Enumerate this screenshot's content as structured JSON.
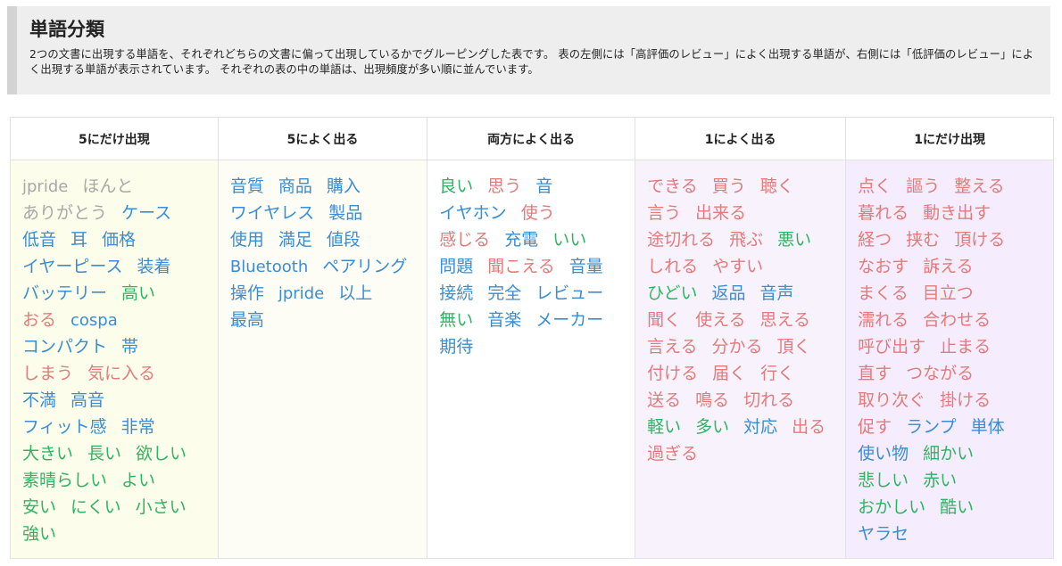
{
  "header": {
    "title": "単語分類",
    "description": "2つの文書に出現する単語を、それぞれどちらの文書に偏って出現しているかでグルーピングした表です。 表の左側には「高評価のレビュー」によく出現する単語が、右側には「低評価のレビュー」によく出現する単語が表示されています。 それぞれの表の中の単語は、出現頻度が多い順に並んでいます。"
  },
  "colors": {
    "blue": "#3a8dd3",
    "green": "#2eb563",
    "red": "#e57a7a",
    "gray": "#a8a8a8"
  },
  "columns": [
    {
      "header": "5にだけ出現",
      "background": "yellow",
      "lines": [
        [
          {
            "text": "jpride",
            "color": "gray"
          },
          {
            "text": "ほんと",
            "color": "gray"
          }
        ],
        [
          {
            "text": "ありがとう",
            "color": "gray"
          },
          {
            "text": "ケース",
            "color": "blue"
          }
        ],
        [
          {
            "text": "低音",
            "color": "blue"
          },
          {
            "text": "耳",
            "color": "blue"
          },
          {
            "text": "価格",
            "color": "blue"
          }
        ],
        [
          {
            "text": "イヤーピース",
            "color": "blue"
          },
          {
            "text": "装着",
            "color": "blue"
          }
        ],
        [
          {
            "text": "バッテリー",
            "color": "blue"
          },
          {
            "text": "高い",
            "color": "green"
          }
        ],
        [
          {
            "text": "おる",
            "color": "red"
          },
          {
            "text": "cospa",
            "color": "blue"
          }
        ],
        [
          {
            "text": "コンパクト",
            "color": "blue"
          },
          {
            "text": "帯",
            "color": "blue"
          }
        ],
        [
          {
            "text": "しまう",
            "color": "red"
          },
          {
            "text": "気に入る",
            "color": "red"
          }
        ],
        [
          {
            "text": "不満",
            "color": "blue"
          },
          {
            "text": "高音",
            "color": "blue"
          }
        ],
        [
          {
            "text": "フィット感",
            "color": "blue"
          },
          {
            "text": "非常",
            "color": "blue"
          }
        ],
        [
          {
            "text": "大きい",
            "color": "green"
          },
          {
            "text": "長い",
            "color": "green"
          },
          {
            "text": "欲しい",
            "color": "green"
          }
        ],
        [
          {
            "text": "素晴らしい",
            "color": "green"
          },
          {
            "text": "よい",
            "color": "green"
          }
        ],
        [
          {
            "text": "安い",
            "color": "green"
          },
          {
            "text": "にくい",
            "color": "green"
          },
          {
            "text": "小さい",
            "color": "green"
          }
        ],
        [
          {
            "text": "強い",
            "color": "green"
          }
        ]
      ]
    },
    {
      "header": "5によく出る",
      "background": "cream",
      "lines": [
        [
          {
            "text": "音質",
            "color": "blue"
          },
          {
            "text": "商品",
            "color": "blue"
          },
          {
            "text": "購入",
            "color": "blue"
          }
        ],
        [
          {
            "text": "ワイヤレス",
            "color": "blue"
          },
          {
            "text": "製品",
            "color": "blue"
          }
        ],
        [
          {
            "text": "使用",
            "color": "blue"
          },
          {
            "text": "満足",
            "color": "blue"
          },
          {
            "text": "値段",
            "color": "blue"
          }
        ],
        [
          {
            "text": "Bluetooth",
            "color": "blue"
          },
          {
            "text": "ペアリング",
            "color": "blue"
          }
        ],
        [
          {
            "text": "操作",
            "color": "blue"
          },
          {
            "text": "jpride",
            "color": "blue"
          },
          {
            "text": "以上",
            "color": "blue"
          }
        ],
        [
          {
            "text": "最高",
            "color": "blue"
          }
        ]
      ]
    },
    {
      "header": "両方によく出る",
      "background": "white",
      "lines": [
        [
          {
            "text": "良い",
            "color": "green"
          },
          {
            "text": "思う",
            "color": "red"
          },
          {
            "text": "音",
            "color": "blue"
          }
        ],
        [
          {
            "text": "イヤホン",
            "color": "blue"
          },
          {
            "text": "使う",
            "color": "red"
          }
        ],
        [
          {
            "text": "感じる",
            "color": "red"
          },
          {
            "text": "充電",
            "color": "blue"
          },
          {
            "text": "いい",
            "color": "green"
          }
        ],
        [
          {
            "text": "問題",
            "color": "blue"
          },
          {
            "text": "聞こえる",
            "color": "red"
          },
          {
            "text": "音量",
            "color": "blue"
          }
        ],
        [
          {
            "text": "接続",
            "color": "blue"
          },
          {
            "text": "完全",
            "color": "blue"
          },
          {
            "text": "レビュー",
            "color": "blue"
          }
        ],
        [
          {
            "text": "無い",
            "color": "green"
          },
          {
            "text": "音楽",
            "color": "blue"
          },
          {
            "text": "メーカー",
            "color": "blue"
          }
        ],
        [
          {
            "text": "期待",
            "color": "blue"
          }
        ]
      ]
    },
    {
      "header": "1によく出る",
      "background": "lavender",
      "lines": [
        [
          {
            "text": "できる",
            "color": "red"
          },
          {
            "text": "買う",
            "color": "red"
          },
          {
            "text": "聴く",
            "color": "red"
          }
        ],
        [
          {
            "text": "言う",
            "color": "red"
          },
          {
            "text": "出来る",
            "color": "red"
          }
        ],
        [
          {
            "text": "途切れる",
            "color": "red"
          },
          {
            "text": "飛ぶ",
            "color": "red"
          },
          {
            "text": "悪い",
            "color": "green"
          }
        ],
        [
          {
            "text": "しれる",
            "color": "red"
          },
          {
            "text": "やすい",
            "color": "red"
          }
        ],
        [
          {
            "text": "ひどい",
            "color": "green"
          },
          {
            "text": "返品",
            "color": "blue"
          },
          {
            "text": "音声",
            "color": "blue"
          }
        ],
        [
          {
            "text": "聞く",
            "color": "red"
          },
          {
            "text": "使える",
            "color": "red"
          },
          {
            "text": "思える",
            "color": "red"
          }
        ],
        [
          {
            "text": "言える",
            "color": "red"
          },
          {
            "text": "分かる",
            "color": "red"
          },
          {
            "text": "頂く",
            "color": "red"
          }
        ],
        [
          {
            "text": "付ける",
            "color": "red"
          },
          {
            "text": "届く",
            "color": "red"
          },
          {
            "text": "行く",
            "color": "red"
          }
        ],
        [
          {
            "text": "送る",
            "color": "red"
          },
          {
            "text": "鳴る",
            "color": "red"
          },
          {
            "text": "切れる",
            "color": "red"
          }
        ],
        [
          {
            "text": "軽い",
            "color": "green"
          },
          {
            "text": "多い",
            "color": "green"
          },
          {
            "text": "対応",
            "color": "blue"
          },
          {
            "text": "出る",
            "color": "red"
          }
        ],
        [
          {
            "text": "過ぎる",
            "color": "red"
          }
        ]
      ]
    },
    {
      "header": "1にだけ出現",
      "background": "lilac",
      "lines": [
        [
          {
            "text": "点く",
            "color": "red"
          },
          {
            "text": "謳う",
            "color": "red"
          },
          {
            "text": "整える",
            "color": "red"
          }
        ],
        [
          {
            "text": "暮れる",
            "color": "red"
          },
          {
            "text": "動き出す",
            "color": "red"
          }
        ],
        [
          {
            "text": "経つ",
            "color": "red"
          },
          {
            "text": "挟む",
            "color": "red"
          },
          {
            "text": "頂ける",
            "color": "red"
          }
        ],
        [
          {
            "text": "なおす",
            "color": "red"
          },
          {
            "text": "訴える",
            "color": "red"
          }
        ],
        [
          {
            "text": "まくる",
            "color": "red"
          },
          {
            "text": "目立つ",
            "color": "red"
          }
        ],
        [
          {
            "text": "濡れる",
            "color": "red"
          },
          {
            "text": "合わせる",
            "color": "red"
          }
        ],
        [
          {
            "text": "呼び出す",
            "color": "red"
          },
          {
            "text": "止まる",
            "color": "red"
          }
        ],
        [
          {
            "text": "直す",
            "color": "red"
          },
          {
            "text": "つながる",
            "color": "red"
          }
        ],
        [
          {
            "text": "取り次ぐ",
            "color": "red"
          },
          {
            "text": "掛ける",
            "color": "red"
          }
        ],
        [
          {
            "text": "促す",
            "color": "red"
          },
          {
            "text": "ランプ",
            "color": "blue"
          },
          {
            "text": "単体",
            "color": "blue"
          }
        ],
        [
          {
            "text": "使い物",
            "color": "blue"
          },
          {
            "text": "細かい",
            "color": "green"
          }
        ],
        [
          {
            "text": "悲しい",
            "color": "green"
          },
          {
            "text": "赤い",
            "color": "green"
          }
        ],
        [
          {
            "text": "おかしい",
            "color": "green"
          },
          {
            "text": "酷い",
            "color": "green"
          }
        ],
        [
          {
            "text": "ヤラセ",
            "color": "blue"
          }
        ]
      ]
    }
  ]
}
